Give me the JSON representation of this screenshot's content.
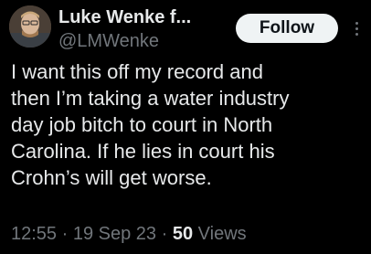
{
  "author": {
    "display_name": "Luke Wenke f...",
    "handle": "@LMWenke",
    "avatar_icon": "user-avatar"
  },
  "actions": {
    "follow_label": "Follow",
    "more_icon": "more-vertical-icon"
  },
  "tweet": {
    "lines": [
      "I want this off my record and",
      "then I’m taking a water industry",
      "day job bitch to court in North",
      "Carolina.  If he lies in court his",
      "Crohn’s will get worse."
    ]
  },
  "meta": {
    "time": "12:55",
    "separator": "·",
    "date": "19 Sep 23",
    "views_count": "50",
    "views_label": "Views"
  },
  "colors": {
    "background": "#000000",
    "text_primary": "#e7e9ea",
    "text_secondary": "#71767b",
    "follow_bg": "#eff3f4"
  }
}
